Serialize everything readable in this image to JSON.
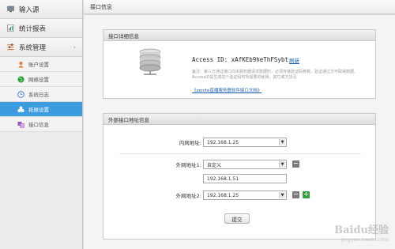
{
  "sidebar": {
    "top_items": [
      {
        "label": "输入源",
        "icon": "monitor-icon"
      },
      {
        "label": "统计报表",
        "icon": "report-icon"
      },
      {
        "label": "系统管理",
        "icon": "settings-icon",
        "chevron": "›"
      }
    ],
    "sub_items": [
      {
        "label": "账户设置",
        "icon": "user-icon",
        "active": false
      },
      {
        "label": "网络设置",
        "icon": "globe-icon",
        "active": false
      },
      {
        "label": "系统日志",
        "icon": "clock-icon",
        "active": false
      },
      {
        "label": "拓展设置",
        "icon": "extension-icon",
        "active": true
      },
      {
        "label": "接口信息",
        "icon": "interface-icon",
        "active": false
      }
    ]
  },
  "header": {
    "title": "接口信息"
  },
  "detail_panel": {
    "title": "接口详细信息",
    "access_id_label": "Access ID:",
    "access_id_value": "xAfKEb9heThFSybt",
    "refresh_link": "刷新",
    "note": "备注：第三方通过接口向本服务器请求数据时，必须传递验证码参数，验证通过方可取得数据。AccessID是生成这个验证码时所需要的秘钥。其它或方法见",
    "doc_link": "《zenite直播服务器软件接口文档》"
  },
  "address_panel": {
    "title": "外部接口地址信息",
    "internal_label": "内网地址:",
    "internal_value": "192.168.1.25",
    "external1_label": "外网地址1:",
    "external1_value": "自定义",
    "external1_custom": "192.168.1.51",
    "external2_label": "外网地址2:",
    "external2_value": "192.168.1.25",
    "submit_label": "提交"
  },
  "watermark": {
    "text_big": "Baidu经验",
    "text_small": "jingyan.baidu.com"
  },
  "colors": {
    "active_bg": "#3d9be0",
    "link": "#1a5fb4",
    "plus": "#2fa33a",
    "minus": "#7a7a7a"
  }
}
